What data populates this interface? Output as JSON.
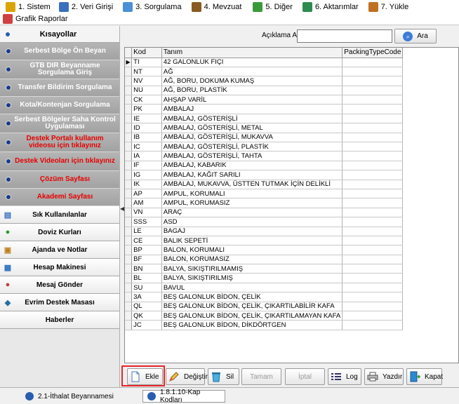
{
  "menu": {
    "items": [
      {
        "label": "1. Sistem",
        "icon": "system-icon",
        "color": "#d9a400"
      },
      {
        "label": "2. Veri Girişi",
        "icon": "data-entry-icon",
        "color": "#3a6fc0"
      },
      {
        "label": "3. Sorgulama",
        "icon": "query-icon",
        "color": "#4a8fd8"
      },
      {
        "label": "4. Mevzuat",
        "icon": "legislation-icon",
        "color": "#8a5a20"
      },
      {
        "label": "5. Diğer",
        "icon": "other-icon",
        "color": "#3a9a3a"
      },
      {
        "label": "6. Aktarımlar",
        "icon": "transfer-icon",
        "color": "#2e8a4e"
      },
      {
        "label": "7. Yükle",
        "icon": "upload-icon",
        "color": "#c07020"
      }
    ],
    "second_row": {
      "label": "Grafik Raporlar",
      "icon": "chart-report-icon",
      "color": "#d04040"
    }
  },
  "sidebar": {
    "header": "Kısayollar",
    "shortcuts": [
      {
        "label": "Serbest Bölge Ön Beyan",
        "red": false,
        "double": false
      },
      {
        "label": "GTB DIR Beyanname Sorgulama Giriş",
        "red": false,
        "double": true
      },
      {
        "label": "Transfer Bildirim Sorgulama",
        "red": false,
        "double": false
      },
      {
        "label": "Kota/Kontenjan Sorgulama",
        "red": false,
        "double": false
      },
      {
        "label": "Serbest Bölgeler Saha Kontrol Uygulaması",
        "red": false,
        "double": true
      },
      {
        "label": "Destek Portalı kullanım videosu için tıklayınız",
        "red": true,
        "double": true
      },
      {
        "label": "Destek Videoları için tıklayınız",
        "red": true,
        "double": true
      },
      {
        "label": "Çözüm Sayfası",
        "red": true,
        "double": false
      },
      {
        "label": "Akademi Sayfası",
        "red": true,
        "double": false
      }
    ],
    "panels": [
      {
        "label": "Sık Kullanılanlar",
        "icon": "favorites-icon",
        "glyph": "▤"
      },
      {
        "label": "Doviz Kurları",
        "icon": "currency-icon",
        "glyph": "●"
      },
      {
        "label": "Ajanda ve Notlar",
        "icon": "agenda-icon",
        "glyph": "▣"
      },
      {
        "label": "Hesap Makinesi",
        "icon": "calculator-icon",
        "glyph": "▦"
      },
      {
        "label": "Mesaj Gönder",
        "icon": "message-icon",
        "glyph": "●"
      },
      {
        "label": "Evrim Destek Masası",
        "icon": "support-icon",
        "glyph": "◆"
      },
      {
        "label": "Haberler",
        "icon": "",
        "glyph": ""
      }
    ]
  },
  "search": {
    "label": "Açıklama Ara",
    "value": "",
    "button": "Ara"
  },
  "table": {
    "headers": [
      "Kod",
      "Tanım",
      "PackingTypeCode"
    ],
    "rows": [
      [
        "TI",
        "42 GALONLUK FIÇI",
        ""
      ],
      [
        "NT",
        "AĞ",
        ""
      ],
      [
        "NV",
        "AĞ, BORU, DOKUMA KUMAŞ",
        ""
      ],
      [
        "NU",
        "AĞ, BORU, PLASTİK",
        ""
      ],
      [
        "CK",
        "AHŞAP VARİL",
        ""
      ],
      [
        "PK",
        "AMBALAJ",
        ""
      ],
      [
        "IE",
        "AMBALAJ, GÖSTERİŞLİ",
        ""
      ],
      [
        "ID",
        "AMBALAJ, GÖSTERİŞLİ, METAL",
        ""
      ],
      [
        "IB",
        "AMBALAJ, GÖSTERİŞLİ, MUKAVVA",
        ""
      ],
      [
        "IC",
        "AMBALAJ, GÖSTERİŞLİ, PLASTİK",
        ""
      ],
      [
        "IA",
        "AMBALAJ, GÖSTERİŞLİ, TAHTA",
        ""
      ],
      [
        "IF",
        "AMBALAJ, KABARIK",
        ""
      ],
      [
        "IG",
        "AMBALAJ, KAĞIT SARILI",
        ""
      ],
      [
        "IK",
        "AMBALAJ, MUKAVVA, ÜSTTEN TUTMAK İÇİN DELİKLİ",
        ""
      ],
      [
        "AP",
        "AMPUL, KORUMALI",
        ""
      ],
      [
        "AM",
        "AMPUL, KORUMASIZ",
        ""
      ],
      [
        "VN",
        "ARAÇ",
        ""
      ],
      [
        "SSS",
        "ASD",
        ""
      ],
      [
        "LE",
        "BAGAJ",
        ""
      ],
      [
        "CE",
        "BALIK SEPETİ",
        ""
      ],
      [
        "BP",
        "BALON, KORUMALI",
        ""
      ],
      [
        "BF",
        "BALON, KORUMASIZ",
        ""
      ],
      [
        "BN",
        "BALYA, SIKIŞTIRILMAMIŞ",
        ""
      ],
      [
        "BL",
        "BALYA, SIKIŞTIRILMIŞ",
        ""
      ],
      [
        "SU",
        "BAVUL",
        ""
      ],
      [
        "3A",
        "BEŞ GALONLUK BİDON, ÇELİK",
        ""
      ],
      [
        "QL",
        "BEŞ GALONLUK BİDON, ÇELİK, ÇIKARTILABİLİR KAFA",
        ""
      ],
      [
        "QK",
        "BEŞ GALONLUK BİDON, ÇELİK, ÇIKARTILAMAYAN KAFA",
        ""
      ],
      [
        "JC",
        "BEŞ GALONLUK BİDON, DİKDÖRTGEN",
        ""
      ]
    ]
  },
  "toolbar": {
    "add": "Ekle",
    "edit": "Değiştir",
    "delete": "Sil",
    "confirm": "Tamam",
    "cancel": "İptal",
    "log": "Log",
    "print": "Yazdır",
    "close": "Kapat"
  },
  "status": {
    "task1": "2.1-İthalat Beyannamesi",
    "task2": "1.8.1.10-Kap Kodları"
  }
}
